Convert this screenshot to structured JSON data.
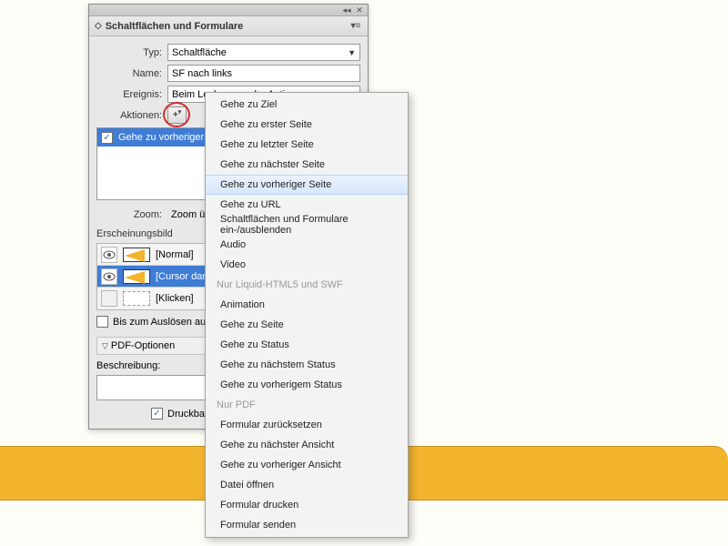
{
  "panel": {
    "title": "Schaltflächen und Formulare",
    "typ_label": "Typ:",
    "typ_value": "Schaltfläche",
    "name_label": "Name:",
    "name_value": "SF nach links",
    "ereignis_label": "Ereignis:",
    "ereignis_value": "Beim Loslassen oder Antippen",
    "aktionen_label": "Aktionen:",
    "action_item": "Gehe zu vorheriger Seite",
    "zoom_label": "Zoom:",
    "zoom_value": "Zoom übernehmen",
    "erscheinung_heading": "Erscheinungsbild",
    "states": [
      {
        "label": "[Normal]"
      },
      {
        "label": "[Cursor darüber]"
      },
      {
        "label": "[Klicken]"
      }
    ],
    "trigger_cb": "Bis zum Auslösen ausgeblendet",
    "pdf_opt_heading": "PDF-Optionen",
    "beschreibung_label": "Beschreibung:",
    "druckbar_label": "Druckbar"
  },
  "menu": {
    "items_main": [
      "Gehe zu Ziel",
      "Gehe zu erster Seite",
      "Gehe zu letzter Seite",
      "Gehe zu nächster Seite",
      "Gehe zu vorheriger Seite",
      "Gehe zu URL",
      "Schaltflächen und Formulare ein-/ausblenden",
      "Audio",
      "Video"
    ],
    "header1": "Nur Liquid-HTML5 und SWF",
    "items_liquid": [
      "Animation",
      "Gehe zu Seite",
      "Gehe zu Status",
      "Gehe zu nächstem Status",
      "Gehe zu vorherigem Status"
    ],
    "header2": "Nur PDF",
    "items_pdf": [
      "Formular zurücksetzen",
      "Gehe zu nächster Ansicht",
      "Gehe zu vorheriger Ansicht",
      "Datei öffnen",
      "Formular drucken",
      "Formular senden"
    ],
    "highlight_index": 4
  }
}
